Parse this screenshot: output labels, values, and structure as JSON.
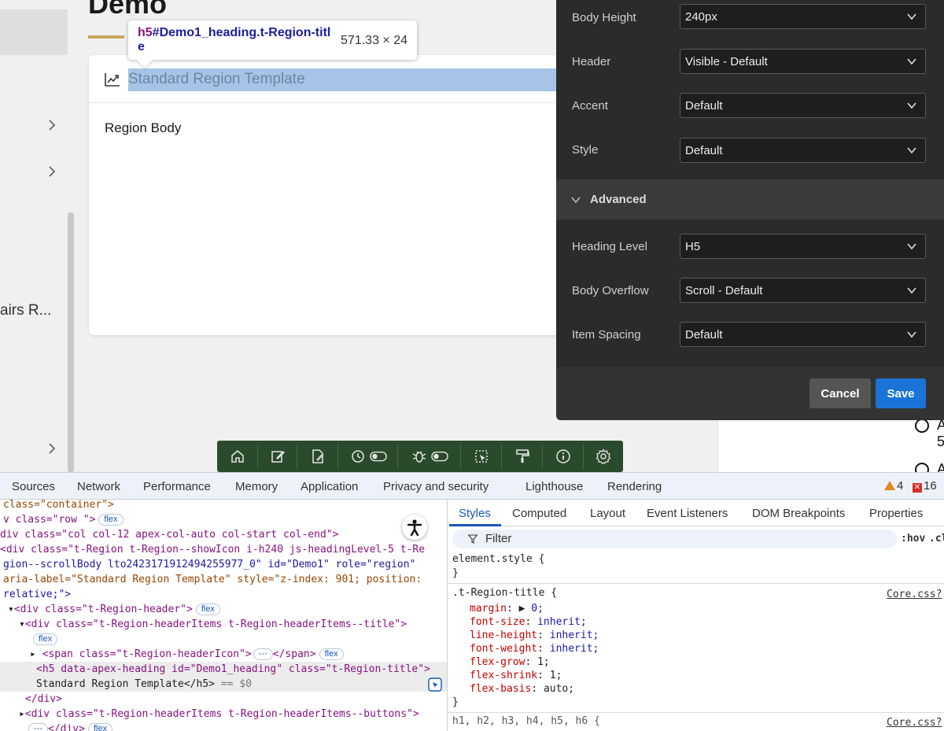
{
  "page": {
    "title": "Demo",
    "nav_truncated_text": "airs R...",
    "region_title": "Standard Region Template",
    "region_body": "Region Body",
    "right_partial_chars": [
      "A",
      "5",
      "A"
    ]
  },
  "inspect_tooltip": {
    "tag": "h5",
    "selector": "#Demo1_heading.t-Region-title",
    "size": "571.33 × 24"
  },
  "panel": {
    "rows": [
      {
        "label": "Body Height",
        "value": "240px"
      },
      {
        "label": "Header",
        "value": "Visible - Default"
      },
      {
        "label": "Accent",
        "value": "Default"
      },
      {
        "label": "Style",
        "value": "Default"
      }
    ],
    "advanced_label": "Advanced",
    "advanced_rows": [
      {
        "label": "Heading Level",
        "value": "H5"
      },
      {
        "label": "Body Overflow",
        "value": "Scroll - Default"
      },
      {
        "label": "Item Spacing",
        "value": "Default"
      }
    ],
    "cancel_label": "Cancel",
    "save_label": "Save"
  },
  "dev_toolbar": {
    "icons": [
      "home-icon",
      "edit-icon",
      "page-edit-icon",
      "session-icon",
      "debug-icon",
      "quick-edit-icon",
      "theme-roller-icon",
      "info-icon",
      "settings-icon"
    ]
  },
  "devtools": {
    "tabs": [
      "Sources",
      "Network",
      "Performance",
      "Memory",
      "Application",
      "Privacy and security",
      "Lighthouse",
      "Rendering"
    ],
    "warnings": "4",
    "errors": "16",
    "styles_tabs": [
      "Styles",
      "Computed",
      "Layout",
      "Event Listeners",
      "DOM Breakpoints",
      "Properties"
    ],
    "filter_placeholder": "Filter",
    "hov": ":hov",
    "cls": ".cls",
    "source_link": "Core.css?",
    "element_style": "element.style {",
    "close_brace": "}",
    "rule_selector": ".t-Region-title {",
    "rule_props": [
      {
        "prop": "margin",
        "value": "0;"
      },
      {
        "prop": "font-size",
        "value": "inherit;"
      },
      {
        "prop": "line-height",
        "value": "inherit;"
      },
      {
        "prop": "font-weight",
        "value": "inherit;"
      },
      {
        "prop": "flex-grow",
        "value": "1;"
      },
      {
        "prop": "flex-shrink",
        "value": "1;"
      },
      {
        "prop": "flex-basis",
        "value": "auto;"
      }
    ],
    "next_rule": "h1, h2, h3, h4, h5, h6 {",
    "dom": {
      "l1": "class=\"container\">",
      "l2a": "v class=\"row \">",
      "l2pill": "flex",
      "l3": "div class=\"col col-12 apex-col-auto col-start col-end\">",
      "l4": "<div class=\"t-Region t-Region--showIcon i-h240 js-headingLevel-5 t-Re",
      "l5": "gion--scrollBody lto2423171912494255977_0\" id=\"Demo1\" role=\"region\"",
      "l6": "aria-label=\"Standard Region Template\" style=\"z-index: 901; position:",
      "l7": "relative;\">",
      "l8": "<div class=\"t-Region-header\">",
      "l9": "<div class=\"t-Region-headerItems t-Region-headerItems--title\">",
      "l10": "<span class=\"t-Region-headerIcon\">",
      "l10b": "</span>",
      "l11": "<h5 data-apex-heading id=\"Demo1_heading\" class=\"t-Region-title\">",
      "l12": "Standard Region Template</h5>",
      "l12b": " == $0",
      "l13": "</div>",
      "l14": "<div class=\"t-Region-headerItems t-Region-headerItems--buttons\">",
      "l15": "</div>"
    }
  }
}
